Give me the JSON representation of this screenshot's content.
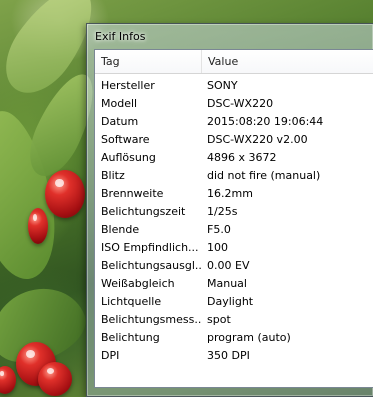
{
  "window": {
    "title": "Exif Infos"
  },
  "table": {
    "columns": [
      "Tag",
      "Value"
    ],
    "rows": [
      {
        "tag": "Hersteller",
        "value": "SONY"
      },
      {
        "tag": "Modell",
        "value": "DSC-WX220"
      },
      {
        "tag": "Datum",
        "value": "2015:08:20 19:06:44"
      },
      {
        "tag": "Software",
        "value": "DSC-WX220 v2.00"
      },
      {
        "tag": "Auflösung",
        "value": "4896 x 3672"
      },
      {
        "tag": "Blitz",
        "value": "did not fire (manual)"
      },
      {
        "tag": "Brennweite",
        "value": "16.2mm"
      },
      {
        "tag": "Belichtungszeit",
        "value": "1/25s"
      },
      {
        "tag": "Blende",
        "value": "F5.0"
      },
      {
        "tag": "ISO Empfindlich...",
        "value": "100"
      },
      {
        "tag": "Belichtungsausgl...",
        "value": "0.00 EV"
      },
      {
        "tag": "Weißabgleich",
        "value": "Manual"
      },
      {
        "tag": "Lichtquelle",
        "value": "Daylight"
      },
      {
        "tag": "Belichtungsmess...",
        "value": "spot"
      },
      {
        "tag": "Belichtung",
        "value": "program (auto)"
      },
      {
        "tag": "DPI",
        "value": "350 DPI"
      }
    ]
  }
}
